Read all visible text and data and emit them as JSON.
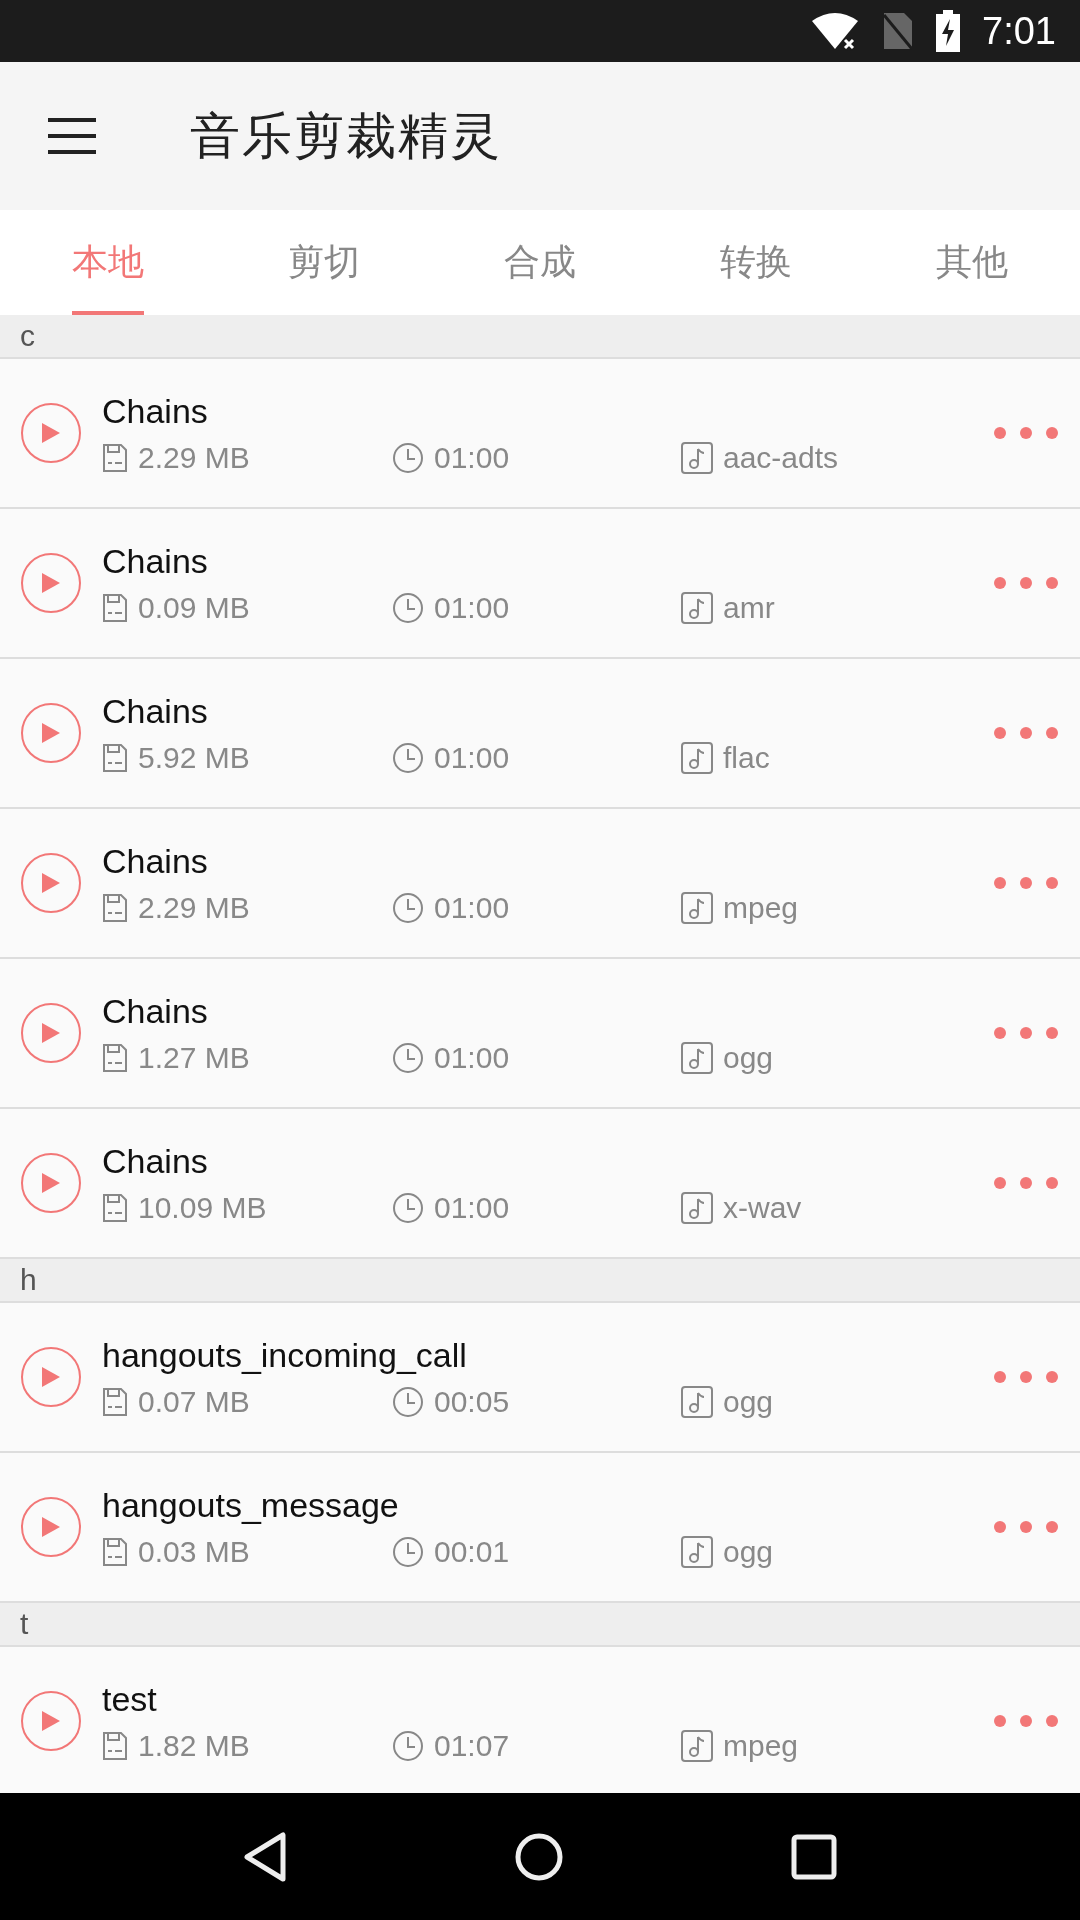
{
  "status_bar": {
    "time": "7:01"
  },
  "app_bar": {
    "title": "音乐剪裁精灵"
  },
  "tabs": [
    {
      "label": "本地",
      "selected": true
    },
    {
      "label": "剪切",
      "selected": false
    },
    {
      "label": "合成",
      "selected": false
    },
    {
      "label": "转换",
      "selected": false
    },
    {
      "label": "其他",
      "selected": false
    }
  ],
  "sections": [
    {
      "header": "c",
      "items": [
        {
          "name": "Chains",
          "size": "2.29 MB",
          "duration": "01:00",
          "format": "aac-adts"
        },
        {
          "name": "Chains",
          "size": "0.09 MB",
          "duration": "01:00",
          "format": "amr"
        },
        {
          "name": "Chains",
          "size": "5.92 MB",
          "duration": "01:00",
          "format": "flac"
        },
        {
          "name": "Chains",
          "size": "2.29 MB",
          "duration": "01:00",
          "format": "mpeg"
        },
        {
          "name": "Chains",
          "size": "1.27 MB",
          "duration": "01:00",
          "format": "ogg"
        },
        {
          "name": "Chains",
          "size": "10.09 MB",
          "duration": "01:00",
          "format": "x-wav"
        }
      ]
    },
    {
      "header": "h",
      "items": [
        {
          "name": "hangouts_incoming_call",
          "size": "0.07 MB",
          "duration": "00:05",
          "format": "ogg"
        },
        {
          "name": "hangouts_message",
          "size": "0.03 MB",
          "duration": "00:01",
          "format": "ogg"
        }
      ]
    },
    {
      "header": "t",
      "items": [
        {
          "name": "test",
          "size": "1.82 MB",
          "duration": "01:07",
          "format": "mpeg"
        }
      ]
    }
  ]
}
